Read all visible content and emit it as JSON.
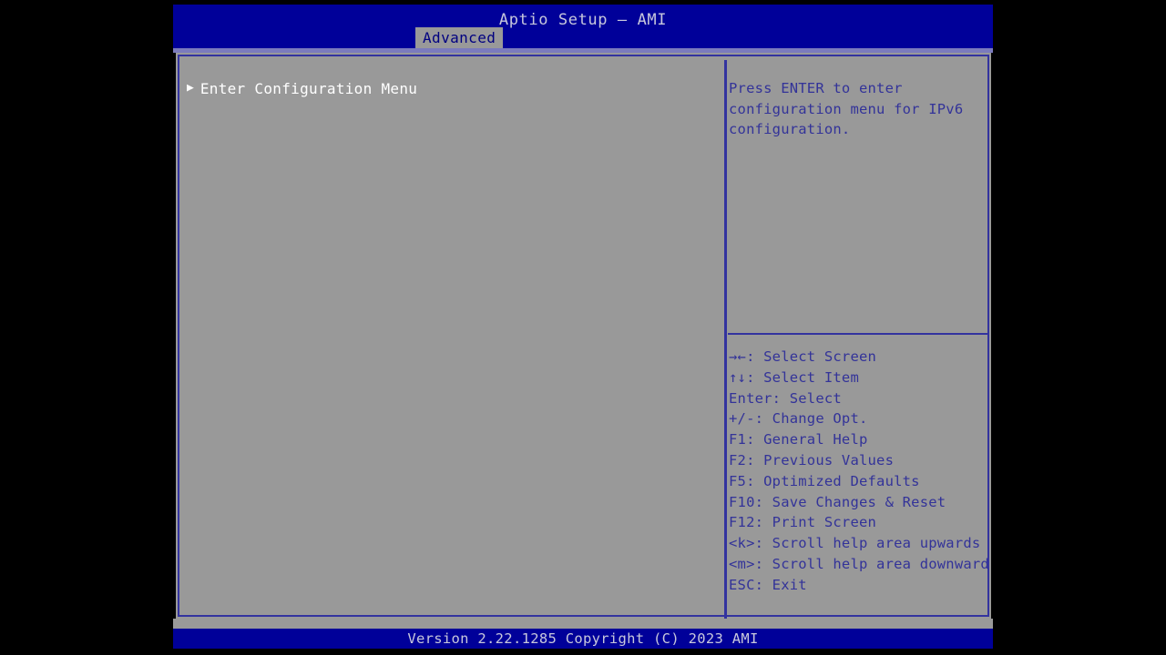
{
  "header": {
    "title": "Aptio Setup – AMI",
    "tabs": [
      {
        "label": "Advanced",
        "active": true
      }
    ]
  },
  "settings": {
    "items": [
      {
        "label": "Enter Configuration Menu",
        "icon": "submenu-arrow-icon",
        "selected": true,
        "has_submenu": true
      }
    ]
  },
  "help": {
    "text": "Press ENTER to enter configuration menu for IPv6 configuration.",
    "legend": [
      {
        "key": "→←",
        "action": ": Select Screen"
      },
      {
        "key": "↑↓",
        "action": ": Select Item"
      },
      {
        "key": "Enter",
        "action": ": Select"
      },
      {
        "key": "+/-",
        "action": ": Change Opt."
      },
      {
        "key": "F1",
        "action": ": General Help"
      },
      {
        "key": "F2",
        "action": ": Previous Values"
      },
      {
        "key": "F5",
        "action": ": Optimized Defaults"
      },
      {
        "key": "F10",
        "action": ": Save Changes & Reset"
      },
      {
        "key": "F12",
        "action": ": Print Screen"
      },
      {
        "key": "<k>",
        "action": ": Scroll help area upwards"
      },
      {
        "key": "<m>",
        "action": ": Scroll help area downwards"
      },
      {
        "key": "ESC",
        "action": ": Exit"
      }
    ]
  },
  "footer": {
    "version_text": "Version 2.22.1285 Copyright (C) 2023 AMI"
  },
  "colors": {
    "header_blue": "#000099",
    "panel_gray": "#999999",
    "border_navy": "#33339f",
    "help_text": "#333399",
    "item_text": "#ffffff",
    "header_text": "#c8c8dc",
    "tab_text": "#000080"
  }
}
